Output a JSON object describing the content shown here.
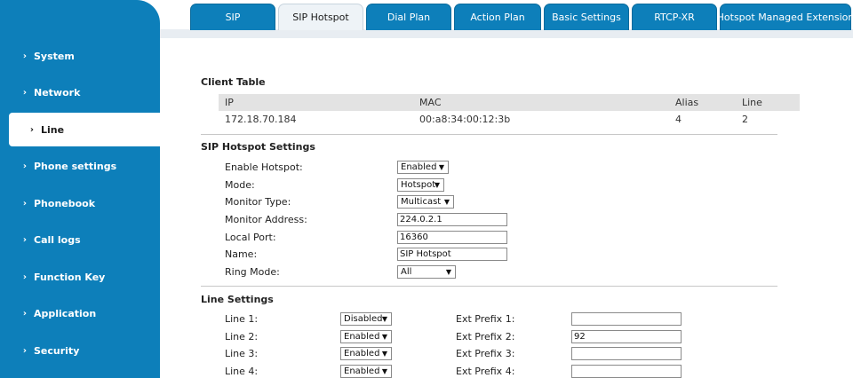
{
  "sidebar": {
    "items": [
      {
        "label": "System",
        "active": false
      },
      {
        "label": "Network",
        "active": false
      },
      {
        "label": "Line",
        "active": true
      },
      {
        "label": "Phone settings",
        "active": false
      },
      {
        "label": "Phonebook",
        "active": false
      },
      {
        "label": "Call logs",
        "active": false
      },
      {
        "label": "Function Key",
        "active": false
      },
      {
        "label": "Application",
        "active": false
      },
      {
        "label": "Security",
        "active": false
      }
    ]
  },
  "tabs": [
    {
      "label": "SIP",
      "active": false
    },
    {
      "label": "SIP Hotspot",
      "active": true
    },
    {
      "label": "Dial Plan",
      "active": false
    },
    {
      "label": "Action Plan",
      "active": false
    },
    {
      "label": "Basic Settings",
      "active": false
    },
    {
      "label": "RTCP-XR",
      "active": false
    },
    {
      "label": "Hotspot Managed Extension",
      "active": false
    }
  ],
  "client_table": {
    "title": "Client Table",
    "headers": [
      "IP",
      "MAC",
      "Alias",
      "Line"
    ],
    "rows": [
      [
        "172.18.70.184",
        "00:a8:34:00:12:3b",
        "4",
        "2"
      ]
    ]
  },
  "hotspot": {
    "title": "SIP Hotspot Settings",
    "enable_label": "Enable Hotspot:",
    "enable_value": "Enabled",
    "mode_label": "Mode:",
    "mode_value": "Hotspot",
    "monitor_type_label": "Monitor Type:",
    "monitor_type_value": "Multicast",
    "monitor_address_label": "Monitor Address:",
    "monitor_address_value": "224.0.2.1",
    "local_port_label": "Local Port:",
    "local_port_value": "16360",
    "name_label": "Name:",
    "name_value": "SIP Hotspot",
    "ring_mode_label": "Ring Mode:",
    "ring_mode_value": "All"
  },
  "line_settings": {
    "title": "Line Settings",
    "lines": [
      {
        "label": "Line 1:",
        "value": "Disabled",
        "prefix_label": "Ext Prefix 1:",
        "prefix_value": ""
      },
      {
        "label": "Line 2:",
        "value": "Enabled",
        "prefix_label": "Ext Prefix 2:",
        "prefix_value": "92"
      },
      {
        "label": "Line 3:",
        "value": "Enabled",
        "prefix_label": "Ext Prefix 3:",
        "prefix_value": ""
      },
      {
        "label": "Line 4:",
        "value": "Enabled",
        "prefix_label": "Ext Prefix 4:",
        "prefix_value": ""
      }
    ]
  },
  "icons": {
    "nav_chevron": "chevron-right-icon",
    "select_arrow": "caret-down-icon"
  },
  "colors": {
    "sidebar": "#0d7fba",
    "tab": "#0d7fba",
    "active_tab": "#eef3f7",
    "table_header": "#e3e3e3"
  }
}
